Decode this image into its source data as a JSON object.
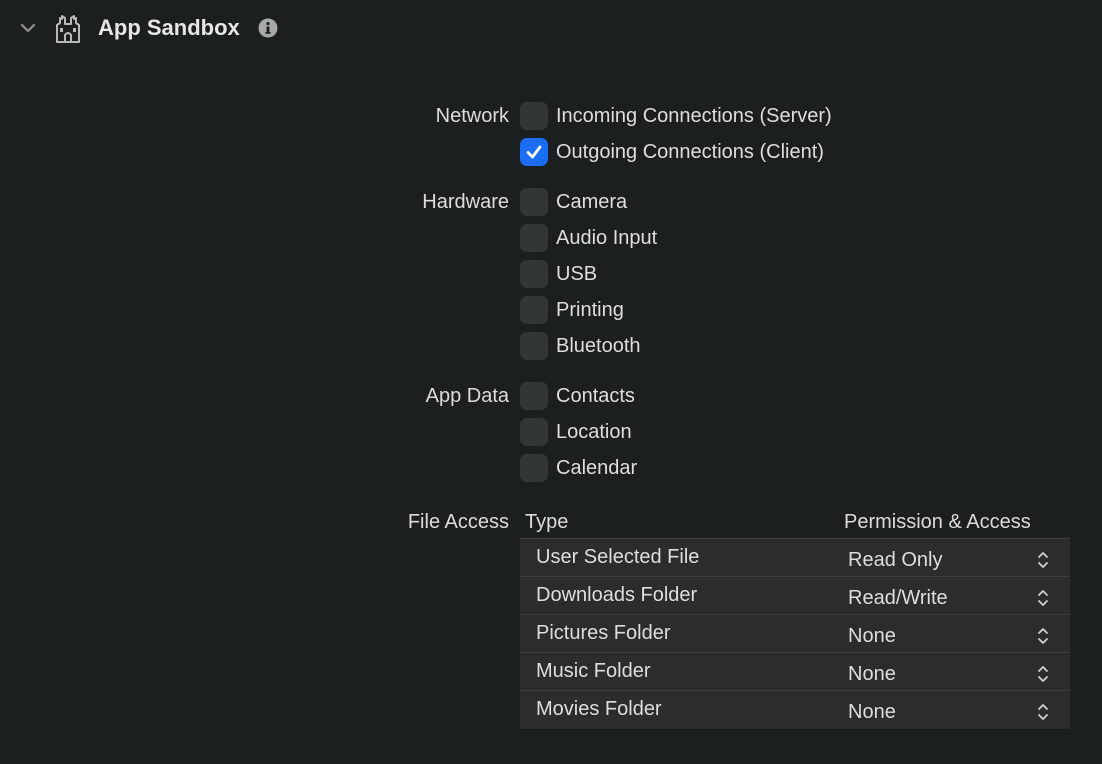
{
  "header": {
    "title": "App Sandbox",
    "disclosure_icon": "chevron-down-icon",
    "section_icon": "sandbox-castle-icon",
    "info_icon": "info-icon"
  },
  "network": {
    "label": "Network",
    "items": [
      {
        "label": "Incoming Connections (Server)",
        "checked": false
      },
      {
        "label": "Outgoing Connections (Client)",
        "checked": true
      }
    ]
  },
  "hardware": {
    "label": "Hardware",
    "items": [
      {
        "label": "Camera",
        "checked": false
      },
      {
        "label": "Audio Input",
        "checked": false
      },
      {
        "label": "USB",
        "checked": false
      },
      {
        "label": "Printing",
        "checked": false
      },
      {
        "label": "Bluetooth",
        "checked": false
      }
    ]
  },
  "app_data": {
    "label": "App Data",
    "items": [
      {
        "label": "Contacts",
        "checked": false
      },
      {
        "label": "Location",
        "checked": false
      },
      {
        "label": "Calendar",
        "checked": false
      }
    ]
  },
  "file_access": {
    "label": "File Access",
    "column_type": "Type",
    "column_permission": "Permission & Access",
    "rows": [
      {
        "type": "User Selected File",
        "permission": "Read Only"
      },
      {
        "type": "Downloads Folder",
        "permission": "Read/Write"
      },
      {
        "type": "Pictures Folder",
        "permission": "None"
      },
      {
        "type": "Music Folder",
        "permission": "None"
      },
      {
        "type": "Movies Folder",
        "permission": "None"
      }
    ]
  },
  "colors": {
    "background": "#1c1f20",
    "checkbox_on": "#1b6ef3",
    "checkbox_off": "#333637",
    "table_bg": "#2a2c2d"
  }
}
